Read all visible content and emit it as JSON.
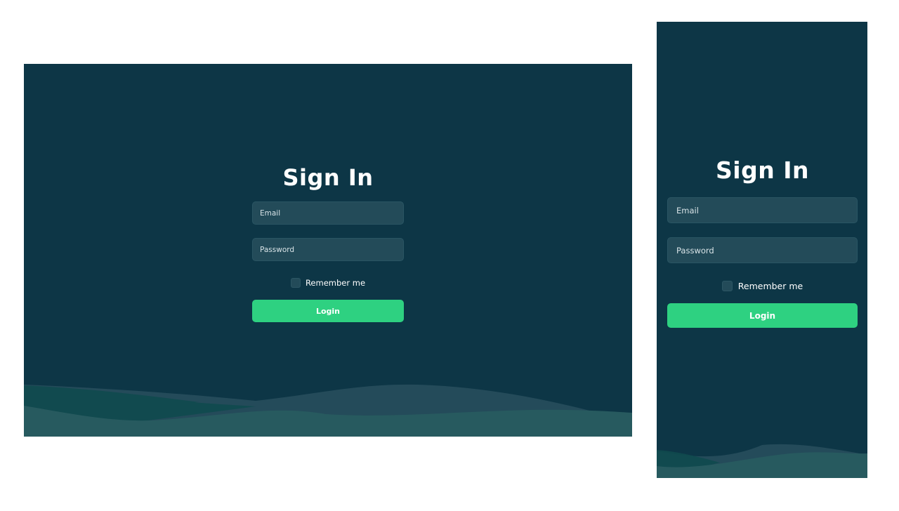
{
  "theme": {
    "background": "#0d3646",
    "field_background": "#234b59",
    "accent": "#2ed181",
    "text": "#ffffff"
  },
  "desktop": {
    "title": "Sign In",
    "email_placeholder": "Email",
    "password_placeholder": "Password",
    "remember_label": "Remember me",
    "remember_checked": false,
    "login_label": "Login"
  },
  "mobile": {
    "title": "Sign In",
    "email_placeholder": "Email",
    "password_placeholder": "Password",
    "remember_label": "Remember me",
    "remember_checked": false,
    "login_label": "Login"
  }
}
